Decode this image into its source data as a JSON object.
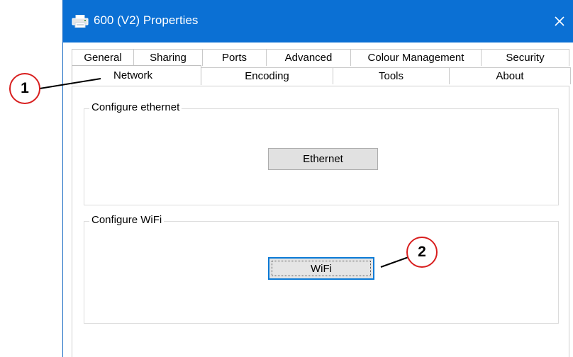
{
  "window": {
    "title": "600 (V2) Properties",
    "title_icon": "printer-icon",
    "close_icon": "close-icon",
    "accent_color": "#0b70d4"
  },
  "tabs": {
    "back_row": [
      "General",
      "Sharing",
      "Ports",
      "Advanced",
      "Colour Management",
      "Security"
    ],
    "front_row": [
      "Network",
      "Encoding",
      "Tools",
      "About"
    ],
    "selected": "Network"
  },
  "network_panel": {
    "ethernet_group": {
      "legend": "Configure ethernet",
      "button_label": "Ethernet"
    },
    "wifi_group": {
      "legend": "Configure WiFi",
      "button_label": "WiFi"
    }
  },
  "callouts": {
    "one": "1",
    "two": "2",
    "color": "#d81e1e"
  }
}
